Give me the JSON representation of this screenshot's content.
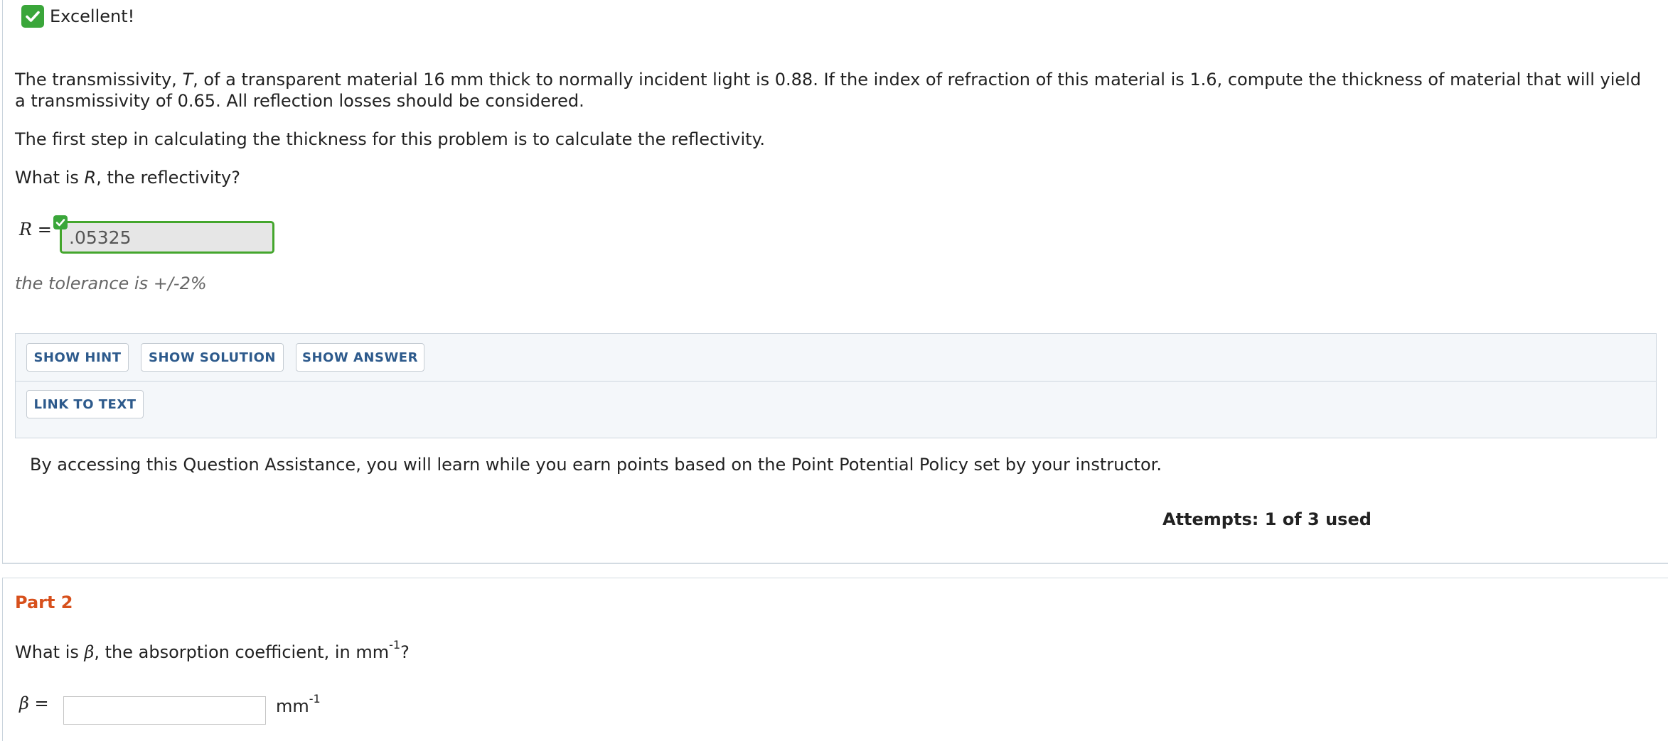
{
  "feedback": {
    "status": "Excellent!",
    "icon": "checkmark-icon",
    "color": "#3aa63a"
  },
  "question": {
    "paragraph1_line1": "The transmissivity, ",
    "symbol_T": "T",
    "paragraph1_rest": ", of a transparent material 16 mm thick to normally incident light is 0.88. If the index of refraction of this material is 1.6, compute the thickness of material that will yield a transmissivity of 0.65. All reflection losses should be considered.",
    "paragraph2": "The first step in calculating the thickness for this problem is to calculate the reflectivity.",
    "paragraph3_prefix": "What is ",
    "symbol_R": "R",
    "paragraph3_suffix": ", the reflectivity?"
  },
  "part1": {
    "answer_label_symbol": "R",
    "answer_label_eq": " =",
    "answer_value": ".05325",
    "answer_correct_color": "#44a62d",
    "tolerance": "the tolerance is +/-2%"
  },
  "assistance": {
    "show_hint": "SHOW HINT",
    "show_solution": "SHOW SOLUTION",
    "show_answer": "SHOW ANSWER",
    "link_to_text": "LINK TO TEXT",
    "policy_text": "By accessing this Question Assistance, you will learn while you earn points based on the Point Potential Policy set by your instructor.",
    "button_text_color": "#2d5a8c"
  },
  "attempts": "Attempts: 1 of 3 used",
  "part2": {
    "title": "Part 2",
    "title_color": "#d7501c",
    "question_prefix": "What is ",
    "symbol_beta": "β",
    "question_middle": ", the absorption coefficient, in mm",
    "question_sup": "-1",
    "question_suffix": "?",
    "input_label_symbol": "β",
    "input_label_eq": " =",
    "input_value": "",
    "unit_base": "mm",
    "unit_sup": "-1"
  }
}
